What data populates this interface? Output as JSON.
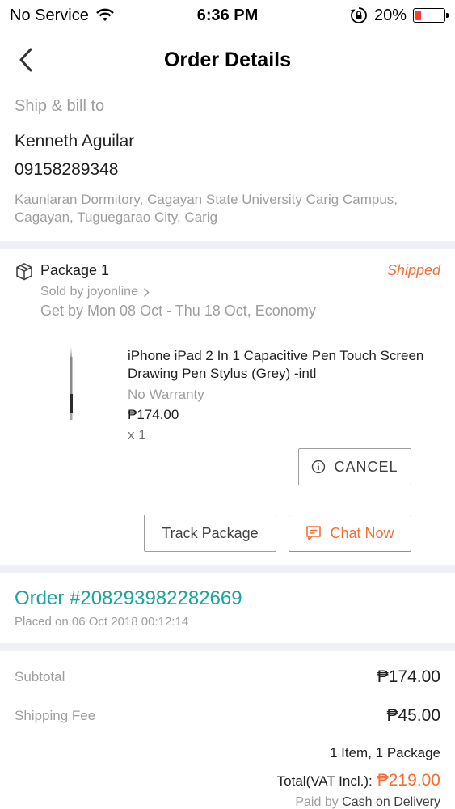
{
  "status_bar": {
    "carrier": "No Service",
    "time": "6:36 PM",
    "battery_percent": "20%",
    "battery_level": 0.2,
    "battery_color": "#ff3b30"
  },
  "header": {
    "title": "Order Details",
    "back_icon": "chevron-left-icon"
  },
  "shipping": {
    "label": "Ship & bill to",
    "name": "Kenneth Aguilar",
    "phone": "09158289348",
    "address": "Kaunlaran Dormitory, Cagayan State University Carig Campus, Cagayan, Tuguegarao City, Carig"
  },
  "package": {
    "title": "Package 1",
    "status": "Shipped",
    "sold_by": "Sold by joyonline",
    "get_by": "Get by Mon 08 Oct - Thu 18 Oct, Economy",
    "product": {
      "name": "iPhone iPad 2 In 1 Capacitive Pen Touch Screen Drawing Pen Stylus (Grey) -intl",
      "warranty": "No Warranty",
      "price": "₱174.00",
      "quantity": "x 1"
    },
    "cancel_label": "CANCEL",
    "track_label": "Track Package",
    "chat_label": "Chat Now"
  },
  "order": {
    "number": "Order #208293982282669",
    "placed_on": "Placed on 06 Oct 2018  00:12:14"
  },
  "totals": {
    "subtotal_label": "Subtotal",
    "subtotal_value": "₱174.00",
    "shipping_label": "Shipping Fee",
    "shipping_value": "₱45.00",
    "items_count": "1 Item, 1 Package",
    "total_label": "Total(VAT Incl.):",
    "total_value": "₱219.00",
    "paid_by_label": "Paid by",
    "paid_by_method": "Cash on Delivery"
  },
  "colors": {
    "accent_orange": "#f36f36",
    "order_teal": "#1aa59b",
    "section_bg": "#eff0f5"
  }
}
